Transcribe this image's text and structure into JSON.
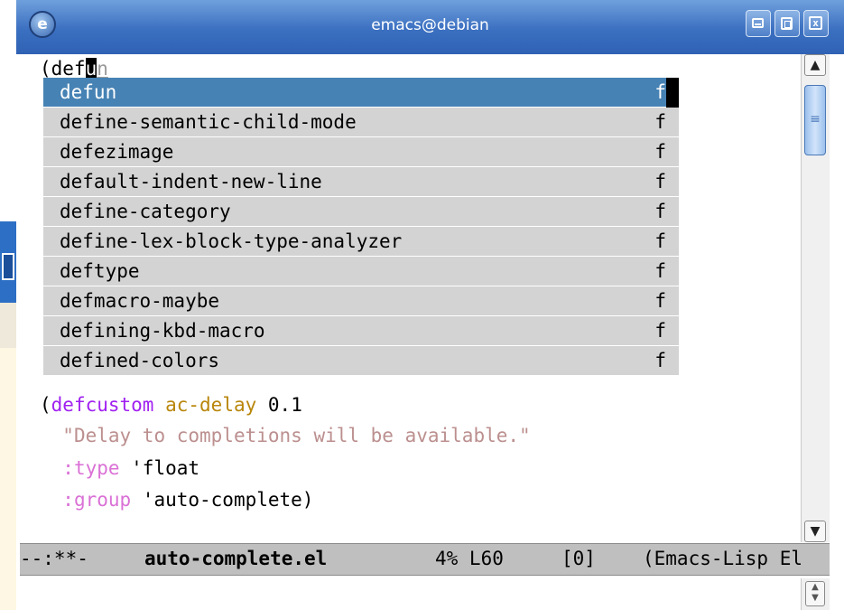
{
  "window": {
    "title": "emacs@debian",
    "app_icon_glyph": "e",
    "close_glyph": "x"
  },
  "editor": {
    "input_line": {
      "prefix": "(def",
      "cursor_char": "u",
      "completion_ghost": "n"
    },
    "code_lines": [
      {
        "paren": "(",
        "keyword": "defcustom",
        "var": "ac-delay",
        "value": " 0.1"
      },
      {
        "indent": "  ",
        "string": "\"Delay to completions will be available.\""
      },
      {
        "indent": "  ",
        "keyword_const": ":type",
        "rest": " 'float"
      },
      {
        "indent": "  ",
        "keyword_const": ":group",
        "rest": " 'auto-complete)"
      }
    ]
  },
  "completion_popup": {
    "selected_index": 0,
    "items": [
      {
        "label": "defun",
        "summary": "f"
      },
      {
        "label": "define-semantic-child-mode",
        "summary": "f"
      },
      {
        "label": "defezimage",
        "summary": "f"
      },
      {
        "label": "default-indent-new-line",
        "summary": "f"
      },
      {
        "label": "define-category",
        "summary": "f"
      },
      {
        "label": "define-lex-block-type-analyzer",
        "summary": "f"
      },
      {
        "label": "deftype",
        "summary": "f"
      },
      {
        "label": "defmacro-maybe",
        "summary": "f"
      },
      {
        "label": "defining-kbd-macro",
        "summary": "f"
      },
      {
        "label": "defined-colors",
        "summary": "f"
      }
    ]
  },
  "modeline": {
    "status": "--:**-",
    "buffer_name": "auto-complete.el",
    "position": "4% L60",
    "extra": "[0]",
    "mode": "(Emacs-Lisp El"
  },
  "colors": {
    "title_bar": "#3b6fc0",
    "popup_bg": "#d3d3d3",
    "popup_selected": "#4682b4",
    "keyword": "#a020f0",
    "variable": "#b8860b",
    "string": "#bc8f8f",
    "constant": "#da70d6",
    "modeline_bg": "#bfbfbf"
  },
  "icons": {
    "app": "emacs-gnu-icon",
    "minimize": "minimize-icon",
    "maximize": "maximize-icon",
    "close": "close-icon",
    "scroll_up": "scroll-up-arrow-icon",
    "scroll_down": "scroll-down-arrow-icon"
  }
}
